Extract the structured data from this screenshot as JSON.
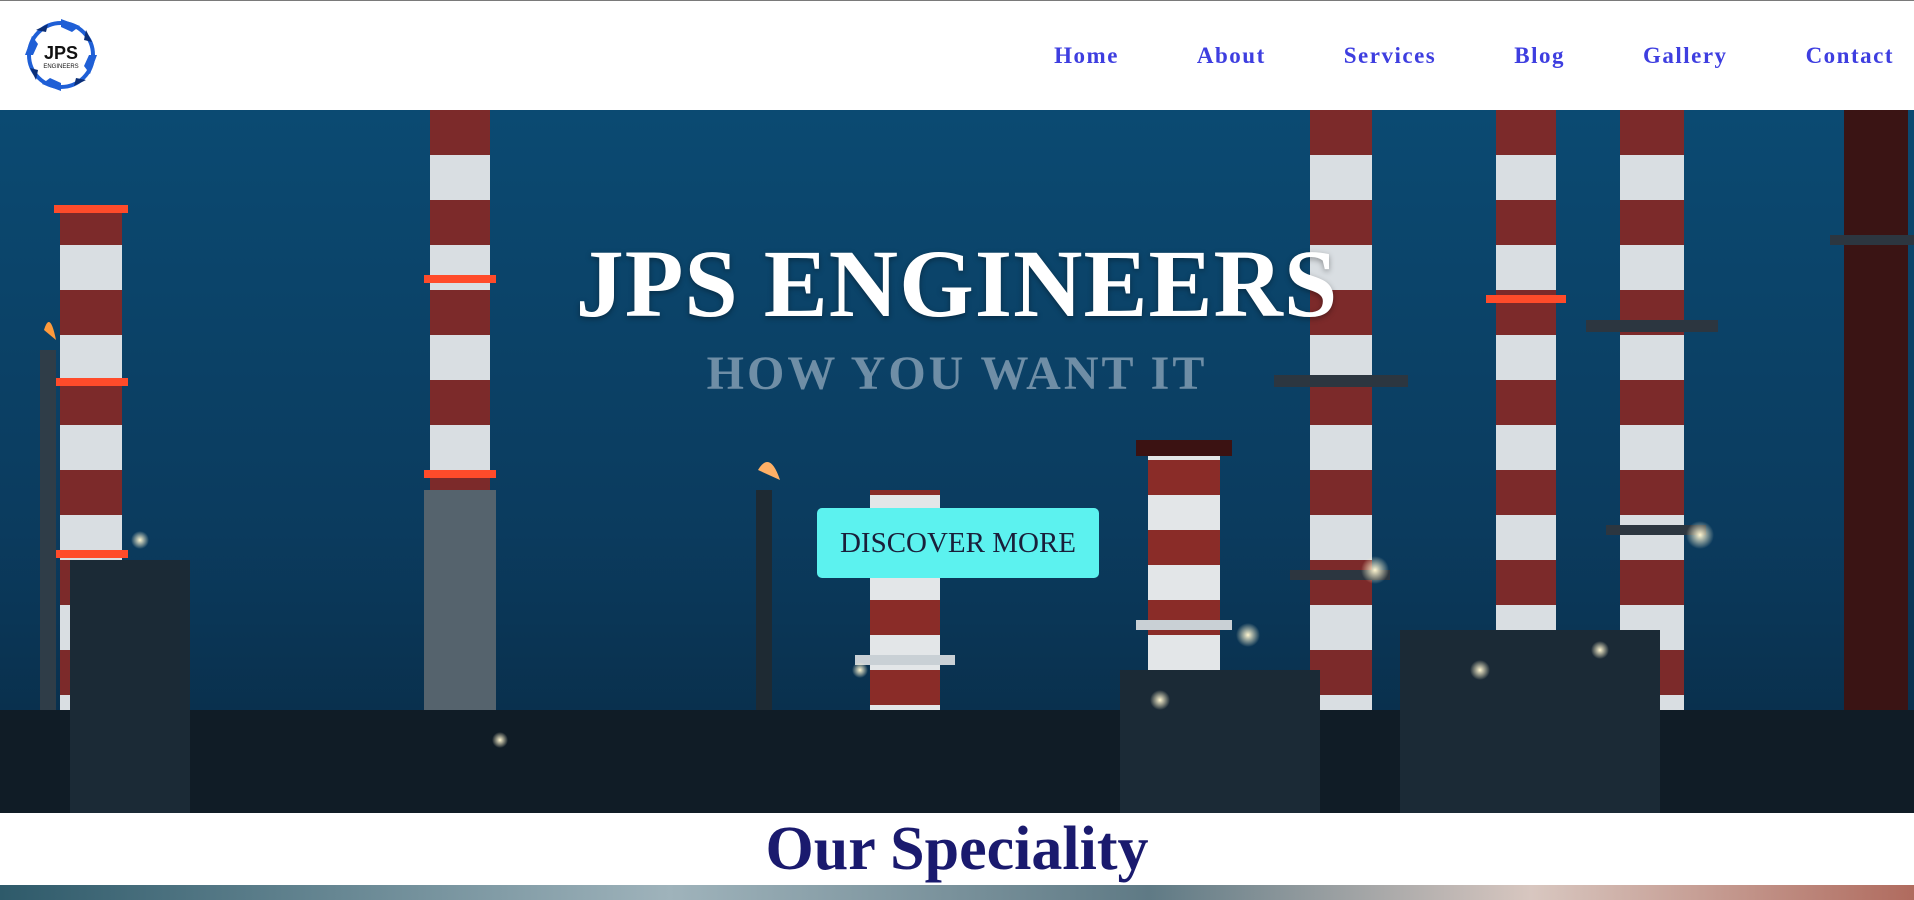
{
  "brand": {
    "logo_text": "JPS",
    "logo_subtext": "ENGINEERS",
    "logo_color": "#1f5fd6"
  },
  "nav": {
    "items": [
      {
        "label": "Home"
      },
      {
        "label": "About"
      },
      {
        "label": "Services"
      },
      {
        "label": "Blog"
      },
      {
        "label": "Gallery"
      },
      {
        "label": "Contact"
      }
    ],
    "color": "#3e3ee0"
  },
  "hero": {
    "title": "JPS ENGINEERS",
    "subtitle": "HOW YOU WANT IT",
    "button_label": "DISCOVER MORE",
    "button_color": "#5cf2ef",
    "background": "industrial refinery smokestacks at dusk"
  },
  "speciality": {
    "title": "Our Speciality",
    "title_color": "#1a1a6e"
  }
}
